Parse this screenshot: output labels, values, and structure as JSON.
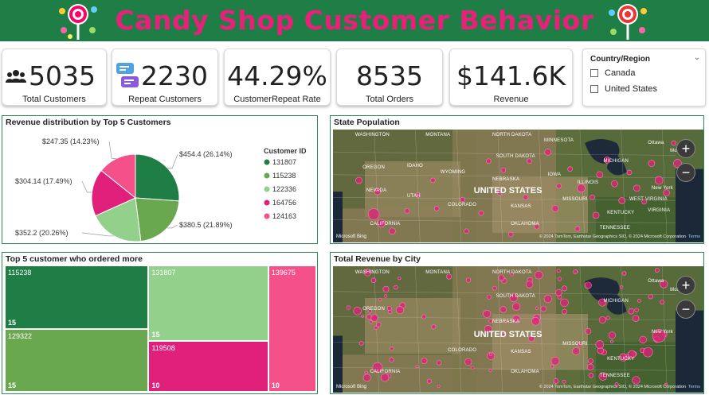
{
  "header": {
    "title": "Candy Shop Customer Behavior"
  },
  "kpis": [
    {
      "value": "5035",
      "label": "Total Customers",
      "icon": "users-icon"
    },
    {
      "value": "2230",
      "label": "Repeat Customers",
      "icon": "chat-icon"
    },
    {
      "value": "44.29%",
      "label": "CustomerRepeat Rate"
    },
    {
      "value": "8535",
      "label": "Total Orders"
    },
    {
      "value": "$141.6K",
      "label": "Revenue"
    }
  ],
  "slicer": {
    "title": "Country/Region",
    "options": [
      "Canada",
      "United States"
    ]
  },
  "pie_panel": {
    "title": "Revenue distribution by Top 5 Customers"
  },
  "treemap_panel": {
    "title": "Top 5 customer who ordered more"
  },
  "state_map": {
    "title": "State Population",
    "country_label": "UNITED STATES",
    "labels": [
      "WASHINGTON",
      "MONTANA",
      "NORTH DAKOTA",
      "MINNESOTA",
      "OREGON",
      "IDAHO",
      "SOUTH DAKOTA",
      "WYOMING",
      "IOWA",
      "NEBRASKA",
      "ILLINOIS",
      "NEVADA",
      "UTAH",
      "COLORADO",
      "KANSAS",
      "MISSOURI",
      "KENTUCKY",
      "WEST VIRGINIA",
      "VIRGINIA",
      "CALIFORNIA",
      "OKLAHOMA",
      "TENNESSEE",
      "MICHIGAN",
      "Ottawa",
      "Montreal",
      "New York"
    ],
    "bing": "Microsoft Bing",
    "copyright": "© 2024 TomTom, Earthstar Geographics SIO, © 2024 Microsoft Corporation",
    "terms": "Terms"
  },
  "city_map": {
    "title": "Total Revenue by City",
    "country_label": "UNITED STATES",
    "labels": [
      "WASHINGTON",
      "MONTANA",
      "NORTH DAKOTA",
      "OREGON",
      "SOUTH DAKOTA",
      "MICHIGAN",
      "NEBRASKA",
      "COLORADO",
      "KANSAS",
      "MISSOURI",
      "KENTUCKY",
      "CALIFORNIA",
      "OKLAHOMA",
      "TENNESSEE",
      "Ottawa",
      "Montreal",
      "New York"
    ],
    "bing": "Microsoft Bing",
    "copyright": "© 2024 TomTom, Earthstar Geographics SIO, © 2024 Microsoft Corporation",
    "terms": "Terms"
  },
  "map_controls": {
    "zoom_in": "+",
    "zoom_out": "−"
  },
  "colors": {
    "green_dark": "#1e7e45",
    "green_mid": "#6aa84f",
    "green_light": "#93d08b",
    "pink_dark": "#e0207a",
    "pink_light": "#f4508a"
  },
  "chart_data": [
    {
      "type": "pie",
      "title": "Revenue distribution by Top 5 Customers",
      "legend_title": "Customer ID",
      "legend_position": "right",
      "categories": [
        "131807",
        "115238",
        "122336",
        "164756",
        "124163"
      ],
      "values": [
        454.4,
        380.5,
        352.2,
        304.14,
        247.35
      ],
      "data_labels": [
        "$454.4 (26.14%)",
        "$380.5 (21.89%)",
        "$352.2 (20.26%)",
        "$304.14 (17.49%)",
        "$247.35 (14.23%)"
      ],
      "colors": [
        "#1e7e45",
        "#6aa84f",
        "#93d08b",
        "#e0207a",
        "#f4508a"
      ]
    },
    {
      "type": "treemap",
      "title": "Top 5 customer who ordered more",
      "categories": [
        "115238",
        "129322",
        "131807",
        "119508",
        "139675"
      ],
      "values": [
        15,
        15,
        15,
        10,
        10
      ],
      "colors": [
        "#1e7e45",
        "#6aa84f",
        "#93d08b",
        "#e0207a",
        "#f4508a"
      ]
    }
  ]
}
